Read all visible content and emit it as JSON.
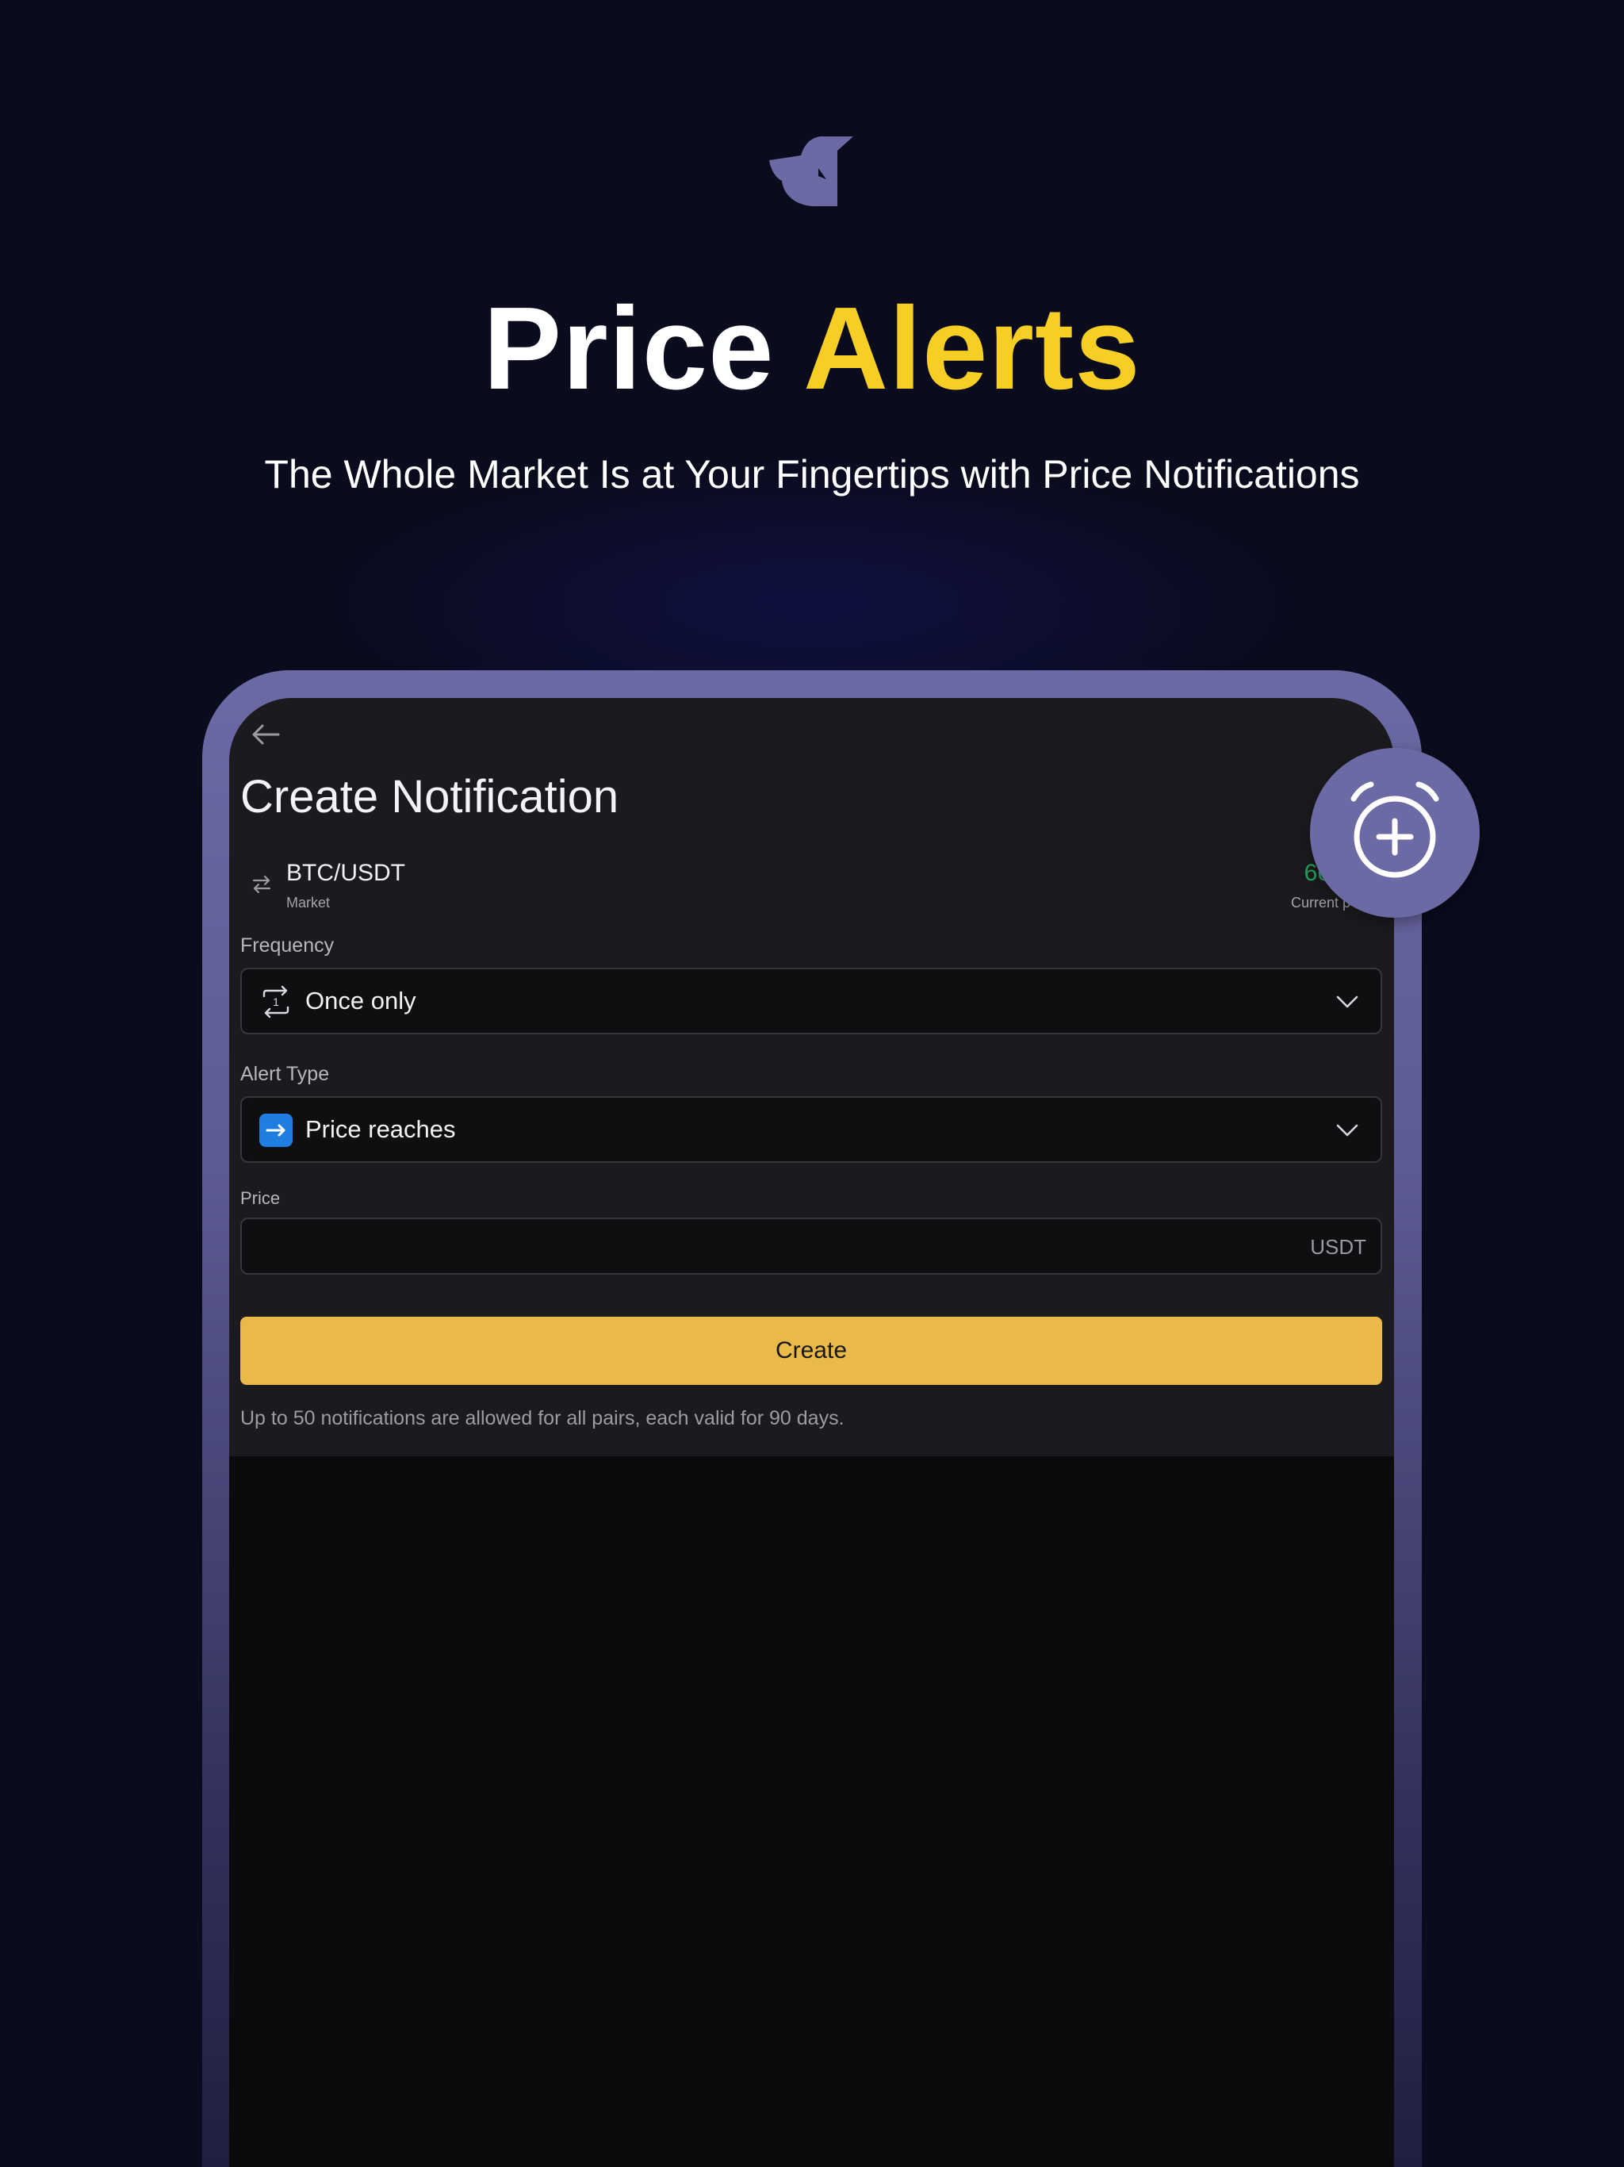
{
  "hero": {
    "title_part1": "Price",
    "title_part2": "Alerts",
    "subtitle": "The Whole Market Is at Your Fingertips with Price Notifications"
  },
  "icons": {
    "logo": "bird-logo-icon",
    "back": "back-arrow-icon",
    "swap": "swap-arrows-icon",
    "frequency": "repeat-once-icon",
    "alert_type": "arrow-right-icon",
    "chevron": "chevron-down-icon",
    "badge": "alarm-clock-plus-icon"
  },
  "colors": {
    "accent_yellow": "#f7cf24",
    "button_yellow": "#e9b949",
    "price_green": "#22a55c",
    "frame_purple": "#6c6aa4",
    "alert_icon_blue": "#1f7fe0",
    "background": "#0a0b1c"
  },
  "screen": {
    "title": "Create Notification",
    "pair": {
      "name": "BTC/USDT",
      "sub": "Market",
      "price": "66,5",
      "price_sub": "Current p"
    },
    "frequency": {
      "label": "Frequency",
      "value": "Once only"
    },
    "alert_type": {
      "label": "Alert Type",
      "value": "Price reaches"
    },
    "price_field": {
      "label": "Price",
      "unit": "USDT"
    },
    "create_label": "Create",
    "hint": "Up to 50 notifications are allowed for all pairs, each valid for 90 days."
  }
}
